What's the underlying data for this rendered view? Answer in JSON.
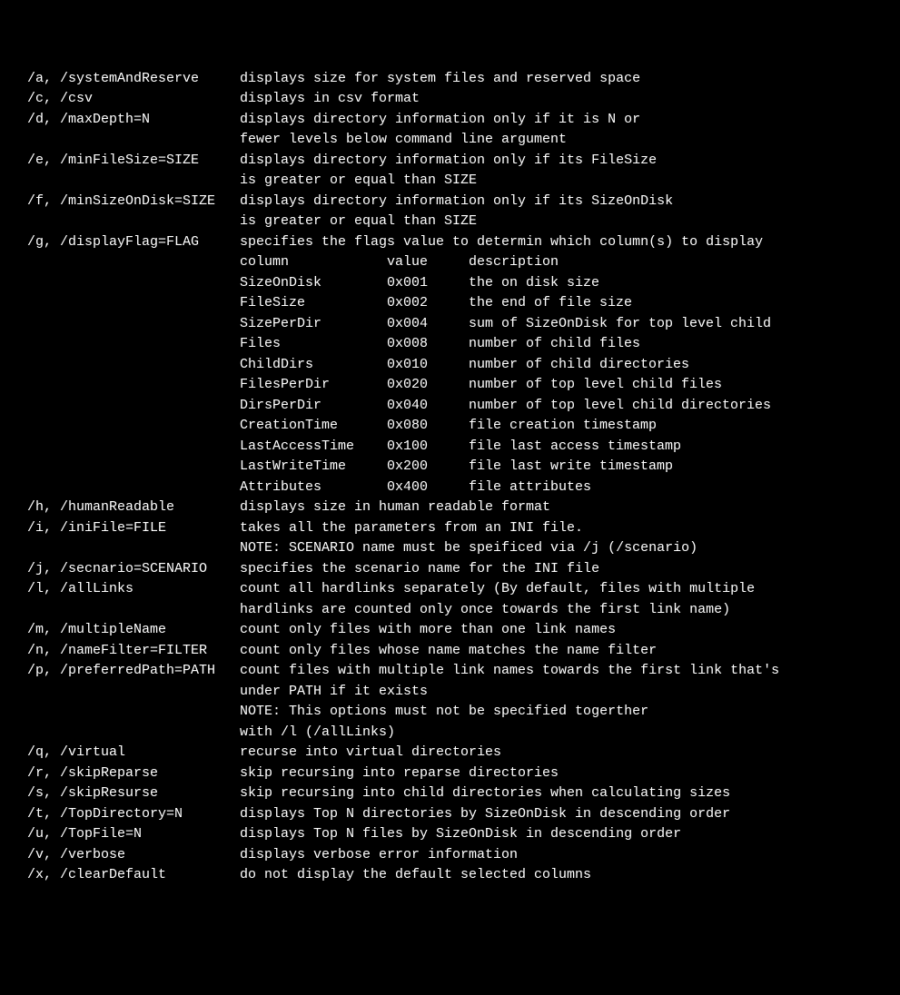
{
  "options": [
    {
      "flags": "  /a, /systemAndReserve",
      "desc": [
        "displays size for system files and reserved space"
      ]
    },
    {
      "flags": "  /c, /csv",
      "desc": [
        "displays in csv format"
      ]
    },
    {
      "flags": "  /d, /maxDepth=N",
      "desc": [
        "displays directory information only if it is N or",
        "fewer levels below command line argument"
      ]
    },
    {
      "flags": "  /e, /minFileSize=SIZE",
      "desc": [
        "displays directory information only if its FileSize",
        "is greater or equal than SIZE"
      ]
    },
    {
      "flags": "  /f, /minSizeOnDisk=SIZE",
      "desc": [
        "displays directory information only if its SizeOnDisk",
        "is greater or equal than SIZE"
      ]
    },
    {
      "flags": "  /g, /displayFlag=FLAG",
      "desc": [
        "specifies the flags value to determin which column(s) to display"
      ]
    }
  ],
  "flagTable": {
    "header": {
      "col": "column",
      "val": "value",
      "desc": "description"
    },
    "rows": [
      {
        "col": "SizeOnDisk",
        "val": "0x001",
        "desc": "the on disk size"
      },
      {
        "col": "FileSize",
        "val": "0x002",
        "desc": "the end of file size"
      },
      {
        "col": "SizePerDir",
        "val": "0x004",
        "desc": "sum of SizeOnDisk for top level child"
      },
      {
        "col": "Files",
        "val": "0x008",
        "desc": "number of child files"
      },
      {
        "col": "ChildDirs",
        "val": "0x010",
        "desc": "number of child directories"
      },
      {
        "col": "FilesPerDir",
        "val": "0x020",
        "desc": "number of top level child files"
      },
      {
        "col": "DirsPerDir",
        "val": "0x040",
        "desc": "number of top level child directories"
      },
      {
        "col": "CreationTime",
        "val": "0x080",
        "desc": "file creation timestamp"
      },
      {
        "col": "LastAccessTime",
        "val": "0x100",
        "desc": "file last access timestamp"
      },
      {
        "col": "LastWriteTime",
        "val": "0x200",
        "desc": "file last write timestamp"
      },
      {
        "col": "Attributes",
        "val": "0x400",
        "desc": "file attributes"
      }
    ]
  },
  "options2": [
    {
      "flags": "  /h, /humanReadable",
      "desc": [
        "displays size in human readable format"
      ]
    },
    {
      "flags": "  /i, /iniFile=FILE",
      "desc": [
        "takes all the parameters from an INI file.",
        "NOTE: SCENARIO name must be speificed via /j (/scenario)"
      ]
    },
    {
      "flags": "  /j, /secnario=SCENARIO",
      "desc": [
        "specifies the scenario name for the INI file"
      ]
    },
    {
      "flags": "  /l, /allLinks",
      "desc": [
        "count all hardlinks separately (By default, files with multiple",
        "hardlinks are counted only once towards the first link name)"
      ]
    },
    {
      "flags": "  /m, /multipleName",
      "desc": [
        "count only files with more than one link names"
      ]
    },
    {
      "flags": "  /n, /nameFilter=FILTER",
      "desc": [
        "count only files whose name matches the name filter"
      ]
    },
    {
      "flags": "  /p, /preferredPath=PATH",
      "desc": [
        "count files with multiple link names towards the first link that's",
        "under PATH if it exists",
        "NOTE: This options must not be specified togerther",
        "with /l (/allLinks)"
      ]
    },
    {
      "flags": "  /q, /virtual",
      "desc": [
        "recurse into virtual directories"
      ]
    },
    {
      "flags": "  /r, /skipReparse",
      "desc": [
        "skip recursing into reparse directories"
      ]
    },
    {
      "flags": "  /s, /skipResurse",
      "desc": [
        "skip recursing into child directories when calculating sizes"
      ]
    },
    {
      "flags": "  /t, /TopDirectory=N",
      "desc": [
        "displays Top N directories by SizeOnDisk in descending order"
      ]
    },
    {
      "flags": "  /u, /TopFile=N",
      "desc": [
        "displays Top N files by SizeOnDisk in descending order"
      ]
    },
    {
      "flags": "  /v, /verbose",
      "desc": [
        "displays verbose error information"
      ]
    },
    {
      "flags": "  /x, /clearDefault",
      "desc": [
        "do not display the default selected columns"
      ]
    }
  ]
}
